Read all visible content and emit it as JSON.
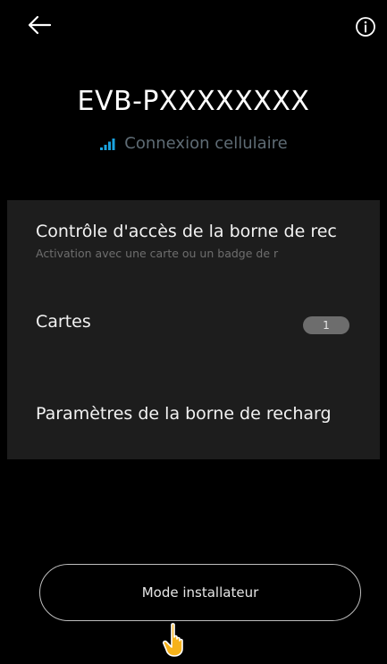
{
  "topbar": {
    "back_icon": "arrow-left-icon",
    "info_icon": "info-circle-icon"
  },
  "device": {
    "title": "EVB-PXXXXXXXX",
    "connection_icon": "signal-bars-icon",
    "connection_label": "Connexion cellulaire"
  },
  "settings": {
    "items": [
      {
        "title": "Contrôle d'accès de la borne de rec",
        "subtitle": "Activation avec une carte ou un badge de r"
      },
      {
        "title": "Cartes",
        "badge": "1"
      },
      {
        "title": "Paramètres de la borne de recharg"
      }
    ]
  },
  "footer": {
    "installer_label": "Mode installateur",
    "pointer_icon": "hand-pointer-icon"
  },
  "colors": {
    "accent": "#1aa3e0",
    "panel": "#1d1d1d",
    "background": "#000000"
  }
}
